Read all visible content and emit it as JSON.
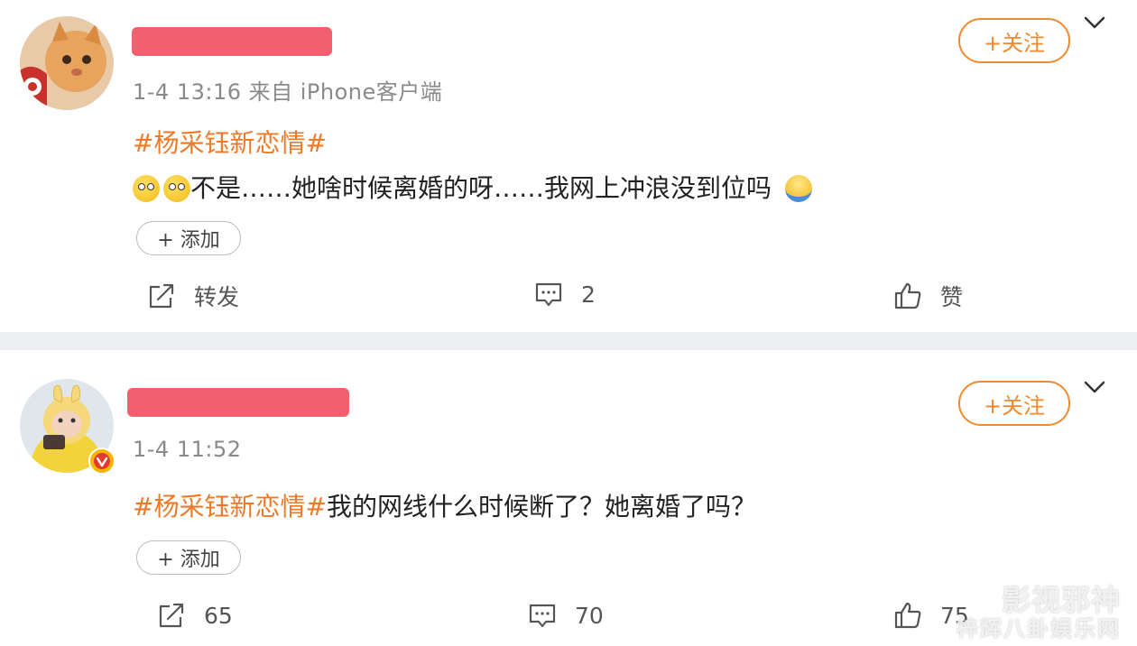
{
  "posts": [
    {
      "meta": "1-4 13:16 来自 iPhone客户端",
      "follow_label": "+关注",
      "topic": "#杨采钰新恋情#",
      "body": "不是……她啥时候离婚的呀……我网上冲浪没到位吗",
      "add_label": "+ 添加",
      "repost_label": "转发",
      "comment_count": "2",
      "like_label": "赞"
    },
    {
      "meta": "1-4 11:52",
      "follow_label": "+关注",
      "topic": "#杨采钰新恋情#",
      "body": "我的网线什么时候断了？她离婚了吗？",
      "add_label": "+ 添加",
      "repost_count": "65",
      "comment_count": "70",
      "like_count": "75"
    }
  ],
  "watermark": {
    "line1": "影视邪神",
    "line2": "梓辉八卦娱乐网"
  },
  "colors": {
    "accent": "#f08a2c",
    "topic": "#eb7a2a",
    "redacted": "#f04f5f",
    "separator": "#eeeff2"
  }
}
